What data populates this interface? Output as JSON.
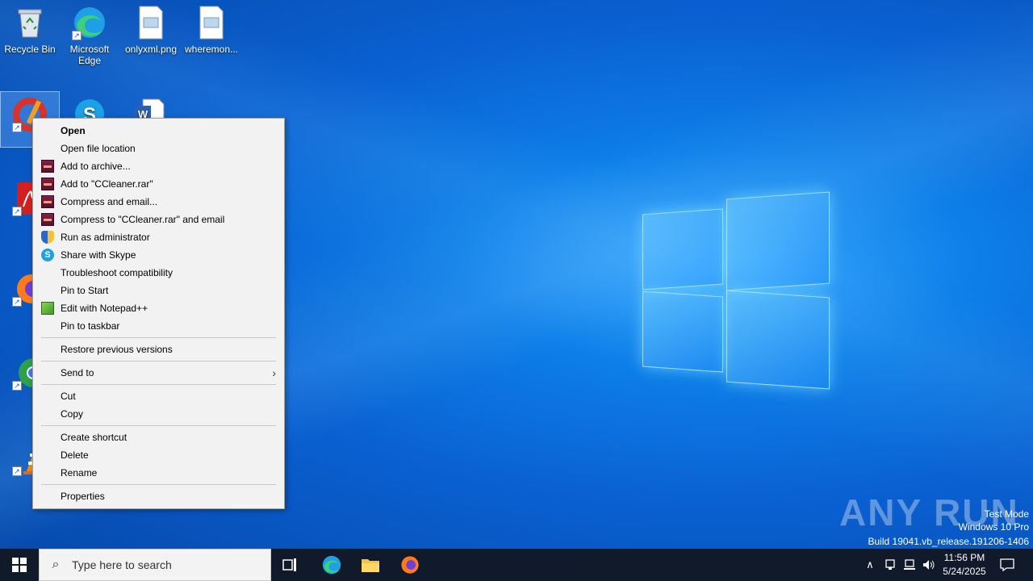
{
  "desktop": {
    "icons": [
      {
        "label": "Recycle Bin"
      },
      {
        "label": "Microsoft Edge"
      },
      {
        "label": "onlyxml.png"
      },
      {
        "label": "wheremon..."
      },
      {
        "label": "CCleaner"
      },
      {
        "label": "Skype"
      },
      {
        "label": "Word"
      },
      {
        "label": "Adobe Acrobat"
      },
      {
        "label": "Firefox"
      },
      {
        "label": "Google Chrome"
      },
      {
        "label": "VLC media player"
      }
    ]
  },
  "context_menu": {
    "items": [
      {
        "label": "Open",
        "icon": ""
      },
      {
        "label": "Open file location",
        "icon": ""
      },
      {
        "label": "Add to archive...",
        "icon": "winrar-icon"
      },
      {
        "label": "Add to \"CCleaner.rar\"",
        "icon": "winrar-icon"
      },
      {
        "label": "Compress and email...",
        "icon": "winrar-icon"
      },
      {
        "label": "Compress to \"CCleaner.rar\" and email",
        "icon": "winrar-icon"
      },
      {
        "label": "Run as administrator",
        "icon": "uac-shield-icon"
      },
      {
        "label": "Share with Skype",
        "icon": "skype-icon"
      },
      {
        "label": "Troubleshoot compatibility",
        "icon": ""
      },
      {
        "label": "Pin to Start",
        "icon": ""
      },
      {
        "label": "Edit with Notepad++",
        "icon": "notepad-plus-plus-icon"
      },
      {
        "label": "Pin to taskbar",
        "icon": ""
      },
      {
        "label": "Restore previous versions",
        "icon": ""
      },
      {
        "label": "Send to",
        "icon": ""
      },
      {
        "label": "Cut",
        "icon": ""
      },
      {
        "label": "Copy",
        "icon": ""
      },
      {
        "label": "Create shortcut",
        "icon": ""
      },
      {
        "label": "Delete",
        "icon": ""
      },
      {
        "label": "Rename",
        "icon": ""
      },
      {
        "label": "Properties",
        "icon": ""
      }
    ]
  },
  "watermark": {
    "brand": "ANY RUN",
    "line1": "Test Mode",
    "line2": "Windows 10 Pro",
    "line3": "Build 19041.vb_release.191206-1406"
  },
  "taskbar": {
    "search_placeholder": "Type here to search",
    "time": "11:56 PM",
    "date": "5/24/2025"
  },
  "colors": {
    "taskbar": "#101a2b",
    "menu_bg": "#f2f2f2",
    "wallpaper_accent": "#0a5fd0"
  }
}
